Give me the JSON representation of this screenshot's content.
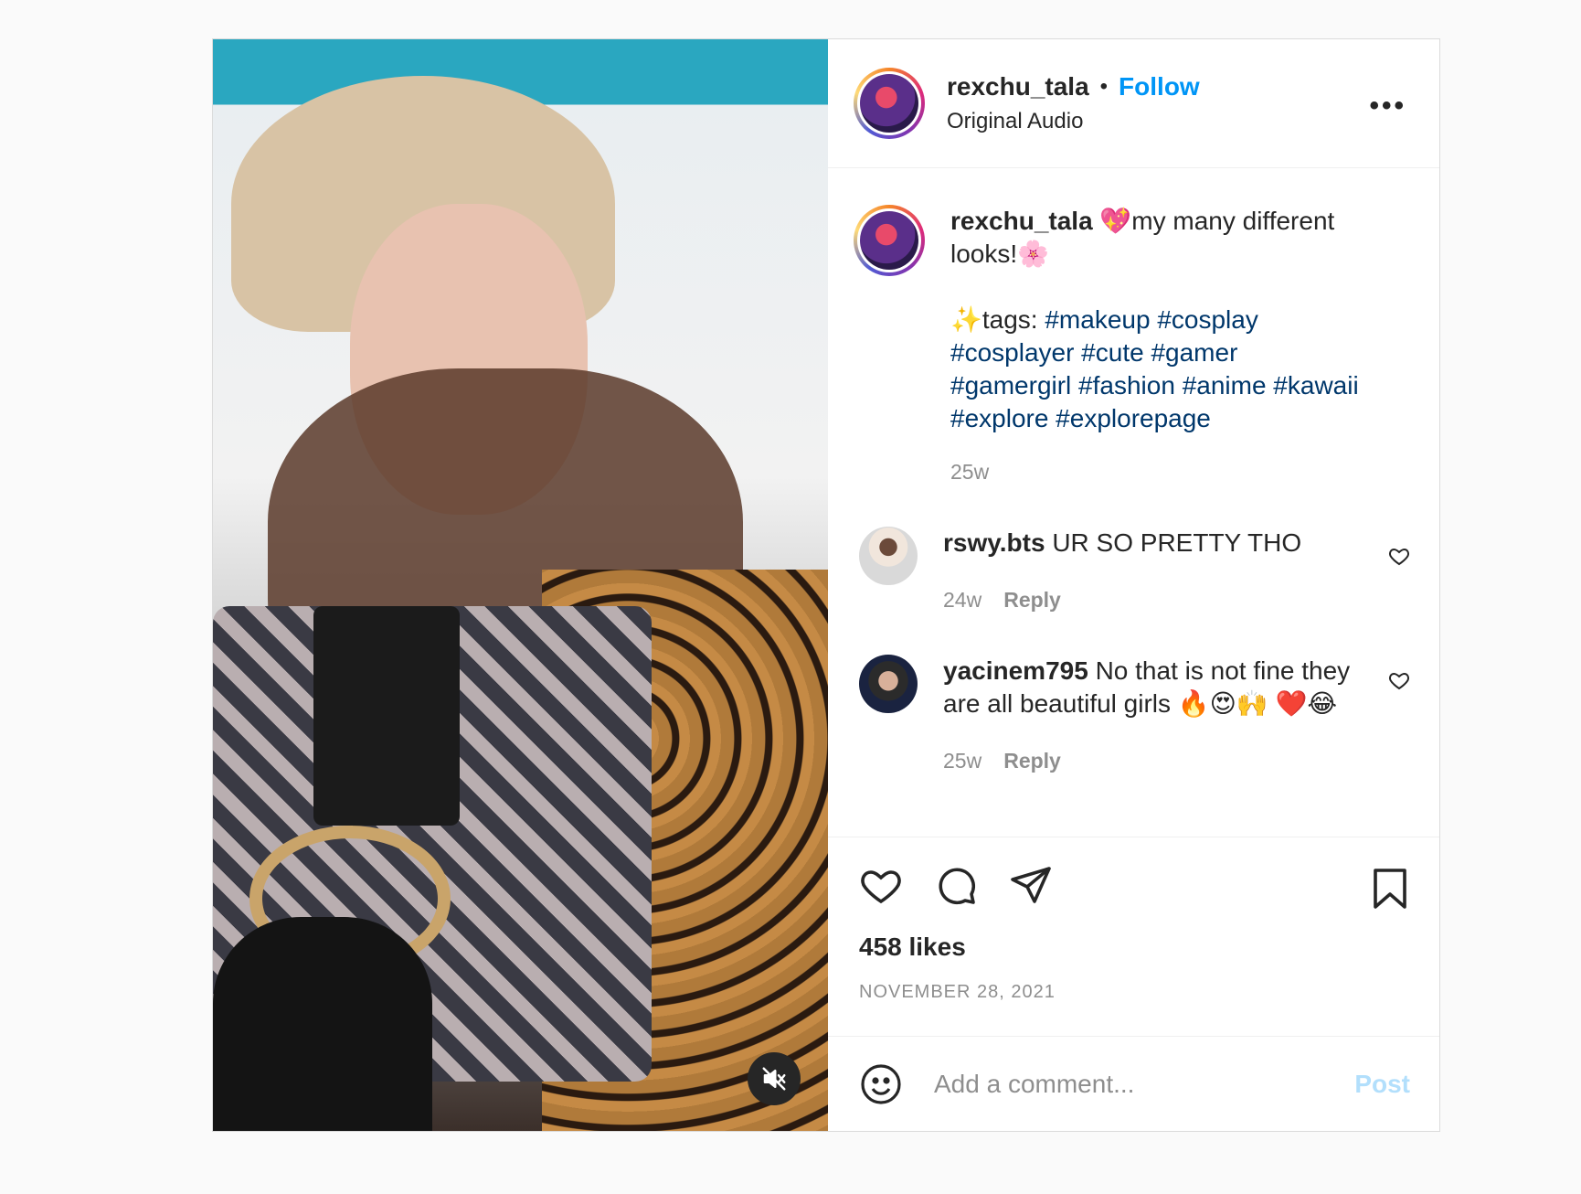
{
  "header": {
    "username": "rexchu_tala",
    "separator": "•",
    "follow_label": "Follow",
    "audio_label": "Original Audio",
    "more_label": "•••"
  },
  "caption": {
    "username": "rexchu_tala",
    "text_line": "💖my many different looks!🌸",
    "tags_prefix": "✨tags: ",
    "hashtags": "#makeup #cosplay #cosplayer #cute #gamer #gamergirl #fashion #anime #kawaii #explore #explorepage",
    "time": "25w"
  },
  "comments": [
    {
      "username": "rswy.bts",
      "text": "UR SO PRETTY THO",
      "time": "24w",
      "reply_label": "Reply"
    },
    {
      "username": "yacinem795",
      "text": "No that is not fine they are all beautiful girls 🔥😍🙌 ❤️😂",
      "time": "25w",
      "reply_label": "Reply"
    }
  ],
  "actions": {
    "likes": "458 likes",
    "date": "NOVEMBER 28, 2021"
  },
  "add_comment": {
    "emoji_icon": "smiley-icon",
    "placeholder": "Add a comment...",
    "post_label": "Post"
  },
  "colors": {
    "follow": "#0095f6",
    "hashtag": "#00376b",
    "post_disabled": "#b2dffc",
    "muted_text": "#8e8e8e"
  }
}
